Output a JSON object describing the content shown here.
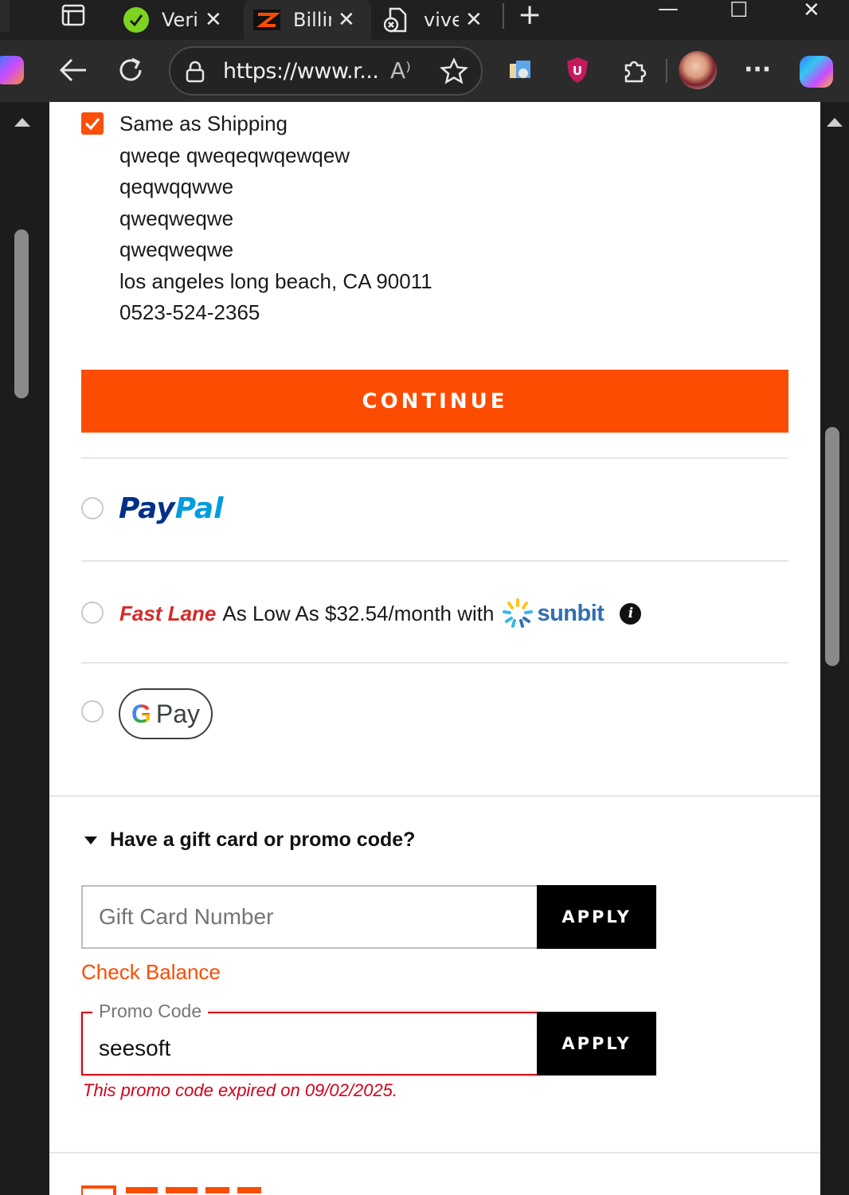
{
  "browser": {
    "tabs": [
      {
        "label": "Veri",
        "close": "✕"
      },
      {
        "label": "Billir",
        "close": "✕"
      },
      {
        "label": "vive",
        "close": "✕"
      }
    ],
    "new_tab": "+",
    "window": {
      "minimize": "—",
      "maximize": "☐",
      "close": "✕"
    },
    "url": "https://www.r...",
    "read_aloud": "A⁾",
    "more": "···"
  },
  "billing": {
    "same_as_shipping_label": "Same as Shipping",
    "address_lines": [
      "qweqe qweqeqwqewqew",
      "qeqwqqwwe",
      "qweqweqwe",
      "qweqweqwe",
      "los angeles long beach, CA 90011",
      "0523-524-2365"
    ],
    "continue_label": "CONTINUE"
  },
  "payment": {
    "paypal": {
      "pay": "Pay",
      "pal": "Pal"
    },
    "fastlane": {
      "brand": "Fast Lane",
      "text": "As Low As $32.54/month with",
      "provider": "sunbit",
      "info": "i"
    },
    "gpay": {
      "g": "G",
      "pay": "Pay"
    }
  },
  "gift": {
    "heading": "Have a gift card or promo code?",
    "gift_card_placeholder": "Gift Card Number",
    "apply_label": "APPLY",
    "check_balance": "Check Balance",
    "promo_label": "Promo Code",
    "promo_value": "seesoft",
    "promo_error": "This promo code expired on 09/02/2025."
  },
  "colors": {
    "accent": "#fc4c02",
    "error": "#d0021b",
    "paypal_dark": "#003087",
    "paypal_light": "#009cde",
    "sunbit": "#2f6fb3"
  }
}
